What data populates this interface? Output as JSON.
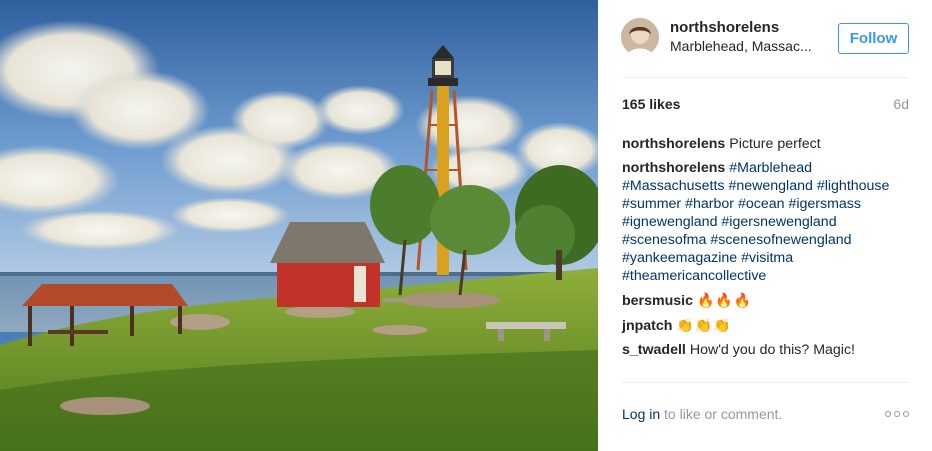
{
  "post": {
    "image_alt": "Lighthouse and red cottage on a grassy point"
  },
  "header": {
    "username": "northshorelens",
    "location": "Marblehead, Massac...",
    "follow_label": "Follow"
  },
  "stats": {
    "likes": "165 likes",
    "time_ago": "6d"
  },
  "caption": {
    "author": "northshorelens",
    "text": "Picture perfect"
  },
  "hashtag_comment": {
    "author": "northshorelens",
    "tags": [
      "#Marblehead",
      "#Massachusetts",
      "#newengland",
      "#lighthouse",
      "#summer",
      "#harbor",
      "#ocean",
      "#igersmass",
      "#ignewengland",
      "#igersnewengland",
      "#scenesofma",
      "#scenesofnewengland",
      "#yankeemagazine",
      "#visitma",
      "#theamericancollective"
    ]
  },
  "comments": [
    {
      "author": "bersmusic",
      "text": "🔥🔥🔥"
    },
    {
      "author": "jnpatch",
      "text": "👏👏👏"
    },
    {
      "author": "s_twadell",
      "text": "How'd you do this? Magic!"
    }
  ],
  "footer": {
    "login_label": "Log in",
    "login_suffix": " to like or comment."
  },
  "colors": {
    "accent": "#3897f0",
    "link": "#003569",
    "muted": "#999999"
  },
  "icons": {
    "more": "more-options-icon"
  }
}
